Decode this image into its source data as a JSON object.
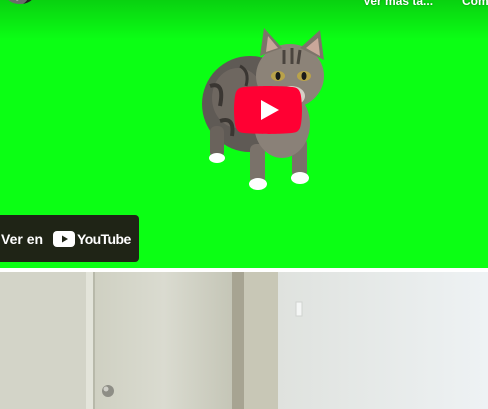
{
  "player": {
    "top_actions": {
      "watch_later": "Ver más ta...",
      "share": "Com"
    },
    "watch_on_label": "Ver en",
    "youtube_wordmark": "YouTube",
    "play_icon": "play-icon",
    "background_color": "#0bff14",
    "accent_red": "#ff0033"
  },
  "room_photo": {
    "icon": "room-photo"
  }
}
